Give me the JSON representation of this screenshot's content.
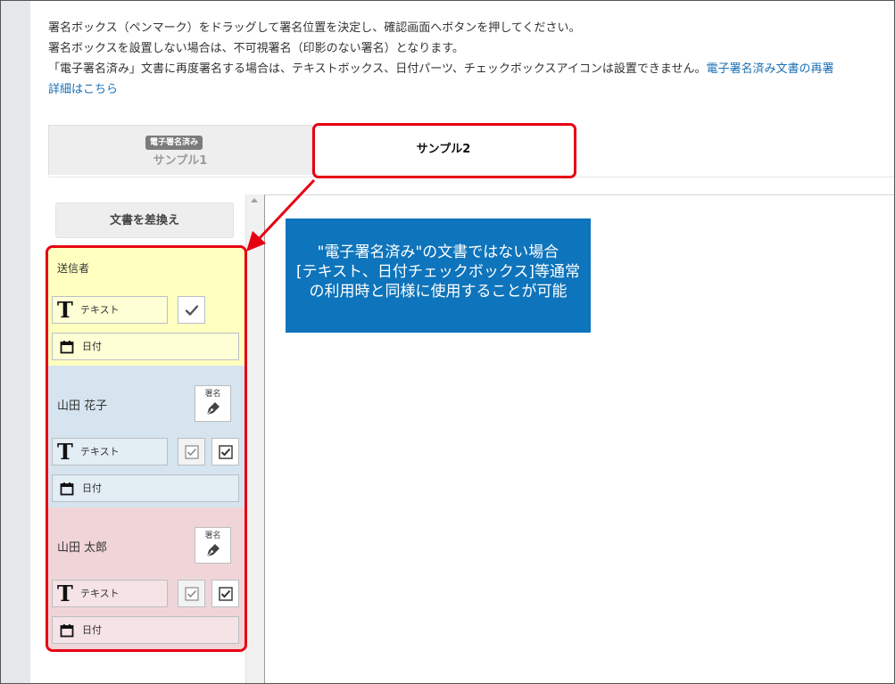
{
  "instructions": {
    "line1": "署名ボックス（ペンマーク）をドラッグして署名位置を決定し、確認画面へボタンを押してください。",
    "line2": "署名ボックスを設置しない場合は、不可視署名（印影のない署名）となります。",
    "line3": "「電子署名済み」文書に再度署名する場合は、テキストボックス、日付パーツ、チェックボックスアイコンは設置できません。",
    "line3_link": "電子署名済み文書の再署",
    "line4_link": "詳細はこちら"
  },
  "tabs": [
    {
      "label": "サンプル1",
      "badge": "電子署名済み",
      "active": false
    },
    {
      "label": "サンプル2",
      "active": true
    }
  ],
  "sidebar": {
    "replace_button": "文書を差換え",
    "signers": [
      {
        "name": "送信者",
        "color": "#ffffc0",
        "text_field": "テキスト",
        "date_field": "日付"
      },
      {
        "name": "山田 花子",
        "color": "#d5e4ee",
        "signature_label": "署名",
        "text_field": "テキスト",
        "date_field": "日付"
      },
      {
        "name": "山田 太郎",
        "color": "#f0d5d8",
        "signature_label": "署名",
        "text_field": "テキスト",
        "date_field": "日付"
      }
    ]
  },
  "callout": {
    "line1": "\"電子署名済み\"の文書ではない場合",
    "line2": "[テキスト、日付チェックボックス]等通常",
    "line3": "の利用時と同様に使用することが可能",
    "background": "#0e74bb"
  },
  "highlight_color": "#e60012",
  "icons": [
    "text-icon",
    "checkbox-icon",
    "calendar-icon",
    "pen-icon"
  ]
}
